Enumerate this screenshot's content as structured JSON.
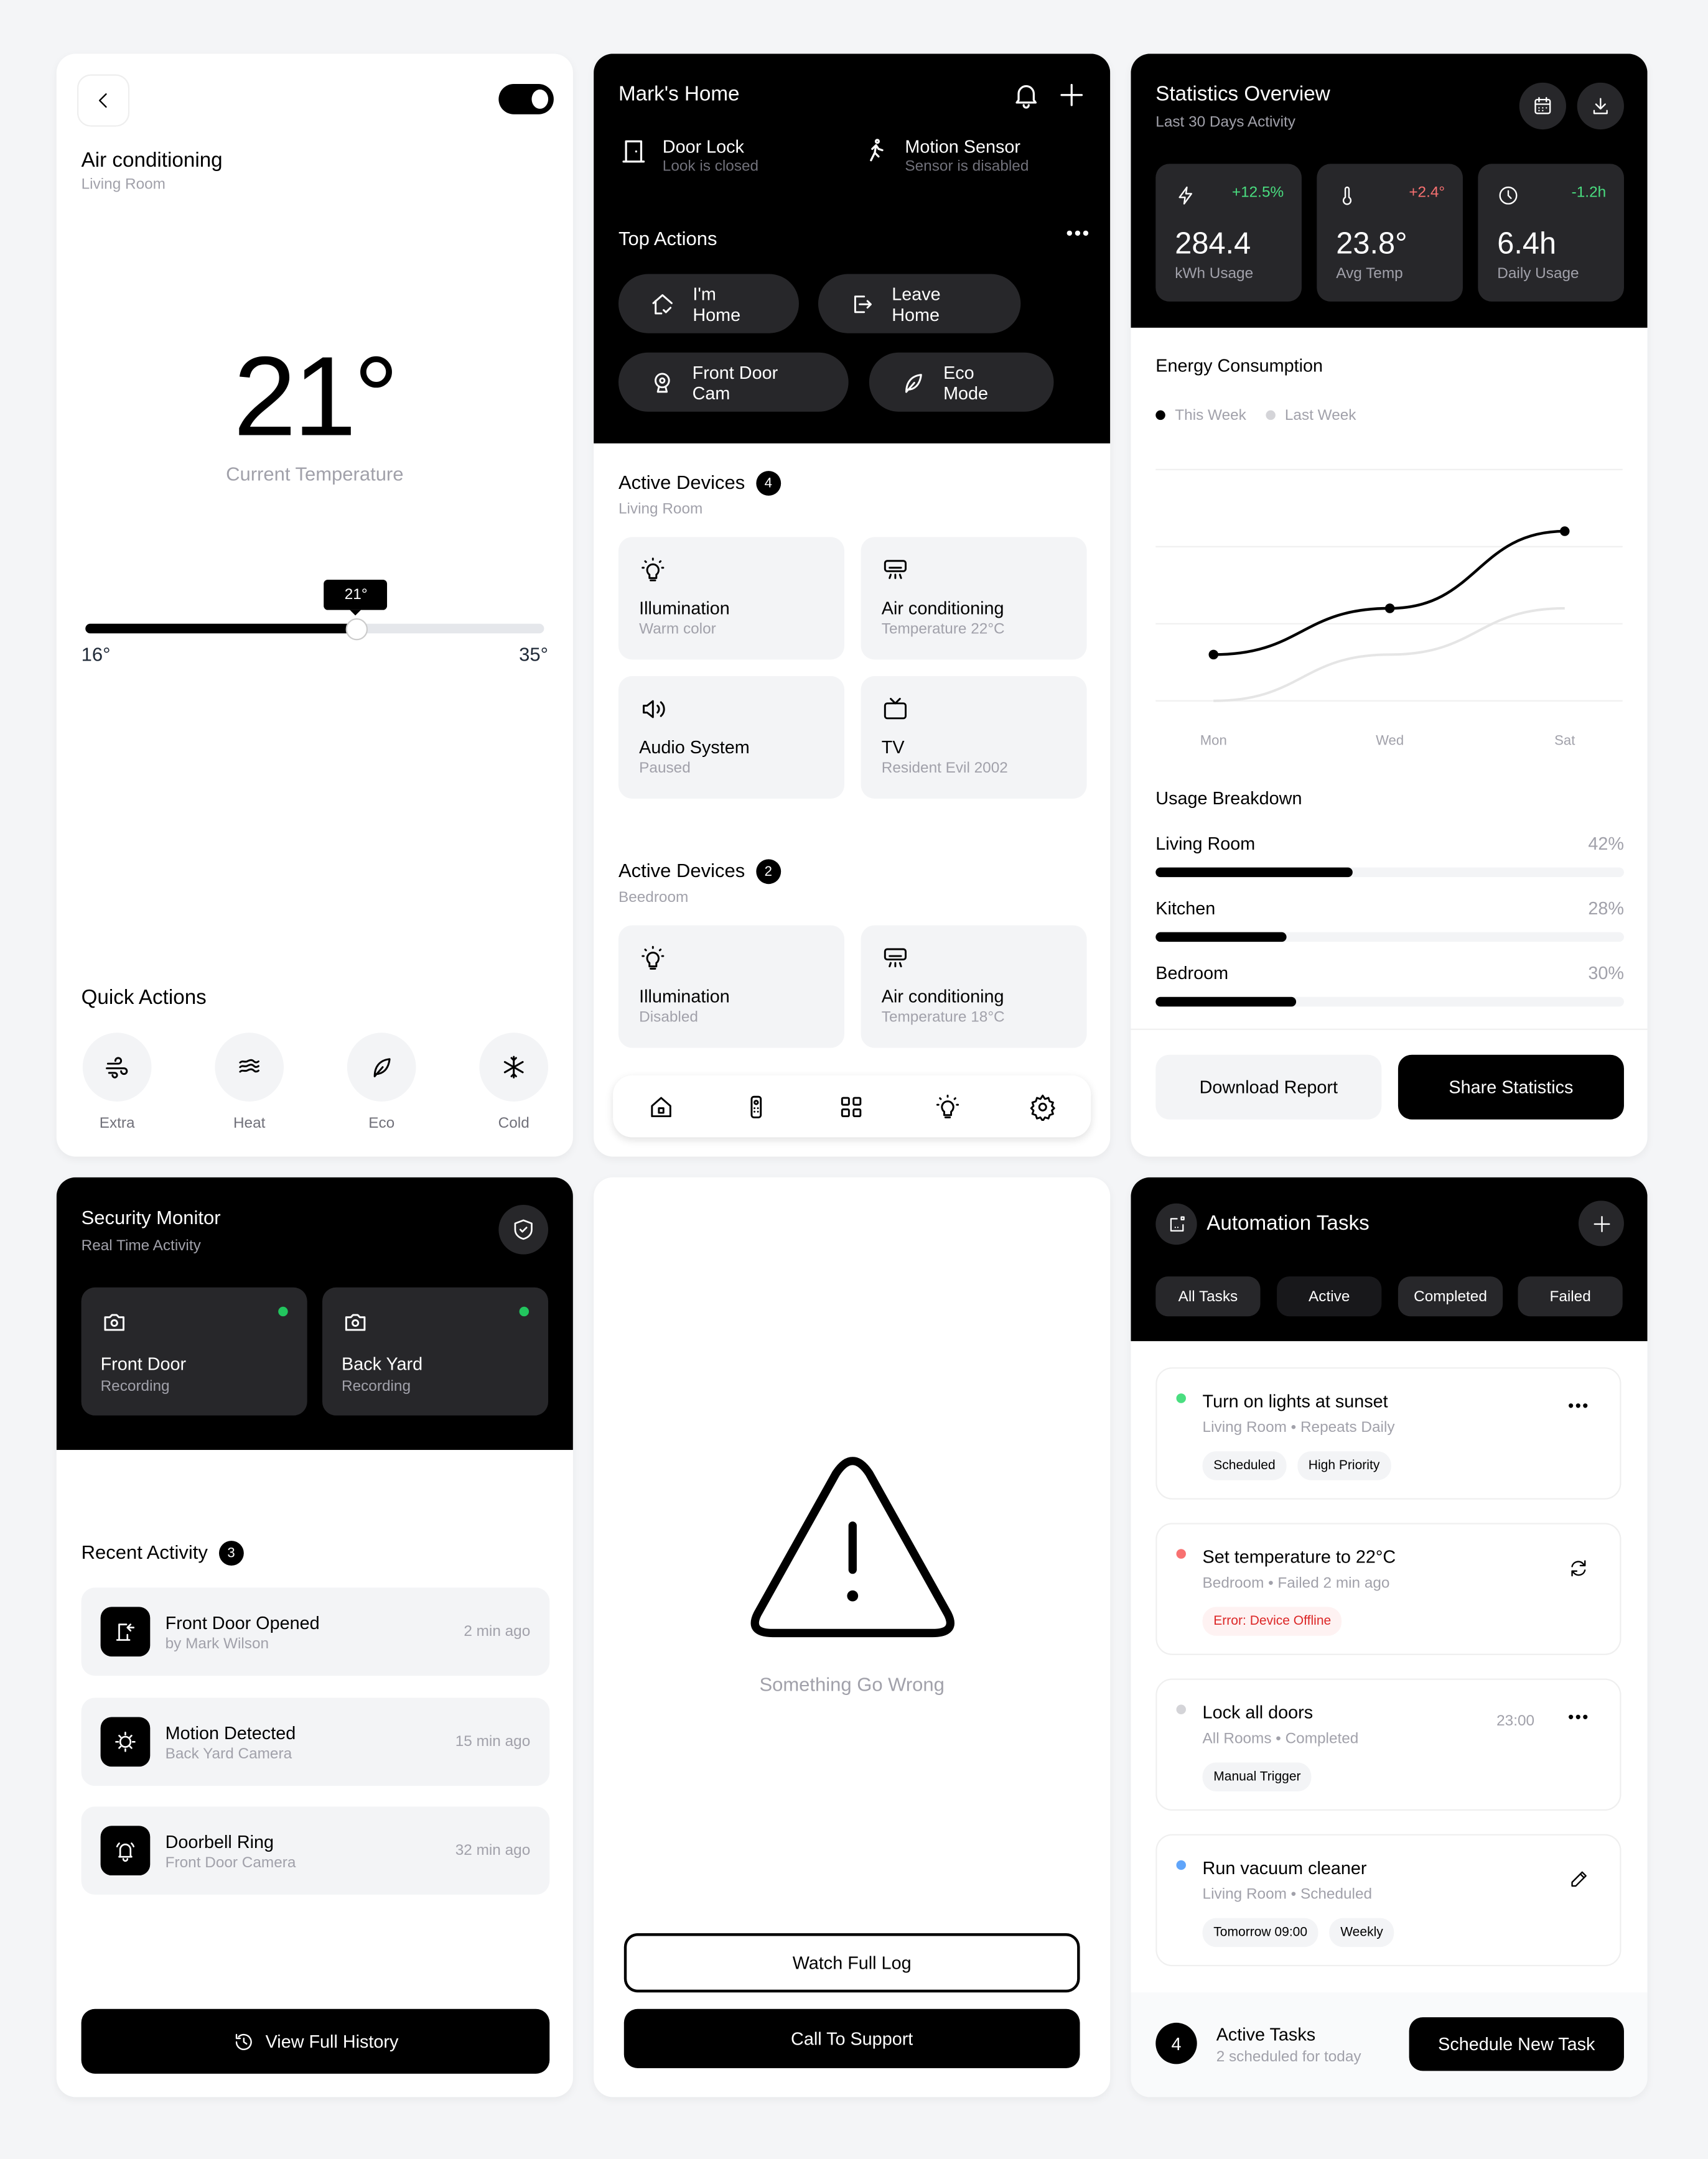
{
  "ac_panel": {
    "title": "Air conditioning",
    "room": "Living Room",
    "power_on": true,
    "current_temp": "21°",
    "current_temp_label": "Current Temperature",
    "slider": {
      "min_label": "16°",
      "max_label": "35°",
      "value_label": "21°",
      "min": 16,
      "max": 35,
      "value": 21,
      "fill_fraction": 0.59
    },
    "quick_actions_title": "Quick Actions",
    "quick_actions": [
      {
        "label": "Extra",
        "icon": "wind-icon"
      },
      {
        "label": "Heat",
        "icon": "waves-icon"
      },
      {
        "label": "Eco",
        "icon": "leaf-icon"
      },
      {
        "label": "Cold",
        "icon": "snowflake-icon"
      }
    ]
  },
  "home_panel": {
    "title": "Mark's Home",
    "status": [
      {
        "name": "Door Lock",
        "sub": "Look is closed",
        "icon": "door-icon"
      },
      {
        "name": "Motion Sensor",
        "sub": "Sensor is disabled",
        "icon": "walking-icon"
      }
    ],
    "top_actions_title": "Top Actions",
    "top_actions": [
      {
        "label": "I'm Home",
        "icon": "home-check-icon"
      },
      {
        "label": "Leave Home",
        "icon": "logout-icon"
      },
      {
        "label": "Front Door Cam",
        "icon": "webcam-icon"
      },
      {
        "label": "Eco Mode",
        "icon": "leaf-icon"
      }
    ],
    "device_groups": [
      {
        "title": "Active Devices",
        "count": "4",
        "room": "Living Room",
        "devices": [
          {
            "name": "Illumination",
            "status": "Warm color",
            "icon": "bulb-icon"
          },
          {
            "name": "Air conditioning",
            "status": "Temperature 22°C",
            "icon": "air-conditioner-icon"
          },
          {
            "name": "Audio System",
            "status": "Paused",
            "icon": "speaker-icon"
          },
          {
            "name": "TV",
            "status": "Resident Evil 2002",
            "icon": "tv-icon"
          }
        ]
      },
      {
        "title": "Active Devices",
        "count": "2",
        "room": "Beedroom",
        "devices": [
          {
            "name": "Illumination",
            "status": "Disabled",
            "icon": "bulb-icon"
          },
          {
            "name": "Air conditioning",
            "status": "Temperature 18°C",
            "icon": "air-conditioner-icon"
          }
        ]
      }
    ],
    "nav": [
      "home-icon",
      "remote-icon",
      "grid-icon",
      "bulb-icon",
      "gear-icon"
    ]
  },
  "stats_panel": {
    "title": "Statistics Overview",
    "subtitle": "Last 30 Days Activity",
    "stats": [
      {
        "value": "284.4",
        "label": "kWh Usage",
        "delta": "+12.5%",
        "delta_color": "#4ade80",
        "icon": "bolt-icon"
      },
      {
        "value": "23.8°",
        "label": "Avg Temp",
        "delta": "+2.4°",
        "delta_color": "#f87171",
        "icon": "thermometer-icon"
      },
      {
        "value": "6.4h",
        "label": "Daily Usage",
        "delta": "-1.2h",
        "delta_color": "#4ade80",
        "icon": "clock-icon"
      }
    ],
    "usage_title": "Usage Breakdown",
    "usage": [
      {
        "room": "Living Room",
        "pct_label": "42%",
        "pct": 42
      },
      {
        "room": "Kitchen",
        "pct_label": "28%",
        "pct": 28
      },
      {
        "room": "Bedroom",
        "pct_label": "30%",
        "pct": 30
      }
    ],
    "download_label": "Download Report",
    "share_label": "Share Statistics"
  },
  "chart_data": {
    "type": "line",
    "title": "Energy Consumption",
    "x": [
      "Mon",
      "Wed",
      "Sat"
    ],
    "series": [
      {
        "name": "This Week",
        "color": "#000000",
        "values": [
          0.6,
          1.2,
          2.2
        ]
      },
      {
        "name": "Last Week",
        "color": "#e5e5e5",
        "values": [
          0.0,
          0.6,
          1.2
        ]
      }
    ],
    "ylim": [
      0,
      3
    ],
    "grid": true,
    "legend": "top-left",
    "xlabel": "",
    "ylabel": ""
  },
  "security_panel": {
    "title": "Security Monitor",
    "subtitle": "Real Time Activity",
    "cameras": [
      {
        "name": "Front Door",
        "status": "Recording"
      },
      {
        "name": "Back Yard",
        "status": "Recording"
      }
    ],
    "activity_title": "Recent Activity",
    "activity_count": "3",
    "activity": [
      {
        "title": "Front Door Opened",
        "sub": "by Mark Wilson",
        "time": "2 min ago",
        "icon": "door-enter-icon"
      },
      {
        "title": "Motion Detected",
        "sub": "Back Yard Camera",
        "time": "15 min ago",
        "icon": "motion-sun-icon"
      },
      {
        "title": "Doorbell Ring",
        "sub": "Front Door Camera",
        "time": "32 min ago",
        "icon": "bell-ring-icon"
      }
    ],
    "history_label": "View Full History"
  },
  "error_panel": {
    "message": "Something Go Wrong",
    "watch_log_label": "Watch Full Log",
    "support_label": "Call To Support"
  },
  "tasks_panel": {
    "title": "Automation Tasks",
    "tabs": [
      "All Tasks",
      "Active",
      "Completed",
      "Failed"
    ],
    "selected_tab": "Active",
    "tasks": [
      {
        "title": "Turn on lights at sunset",
        "meta": "Living Room • Repeats Daily",
        "dot": "#4ade80",
        "tags": [
          "Scheduled",
          "High Priority"
        ],
        "action": "more-icon",
        "time": ""
      },
      {
        "title": "Set temperature to 22°C",
        "meta": "Bedroom • Failed 2 min ago",
        "dot": "#f87171",
        "tags": [
          "Error: Device Offline"
        ],
        "action": "refresh-icon",
        "time": ""
      },
      {
        "title": "Lock all doors",
        "meta": "All Rooms • Completed",
        "dot": "#d4d4d8",
        "tags": [
          "Manual Trigger"
        ],
        "action": "more-icon",
        "time": "23:00"
      },
      {
        "title": "Run vacuum cleaner",
        "meta": "Living Room • Scheduled",
        "dot": "#60a5fa",
        "tags": [
          "Tomorrow 09:00",
          "Weekly"
        ],
        "action": "edit-icon",
        "time": ""
      }
    ],
    "active_count": "4",
    "active_label": "Active Tasks",
    "active_sub": "2 scheduled for today",
    "schedule_label": "Schedule New Task"
  }
}
